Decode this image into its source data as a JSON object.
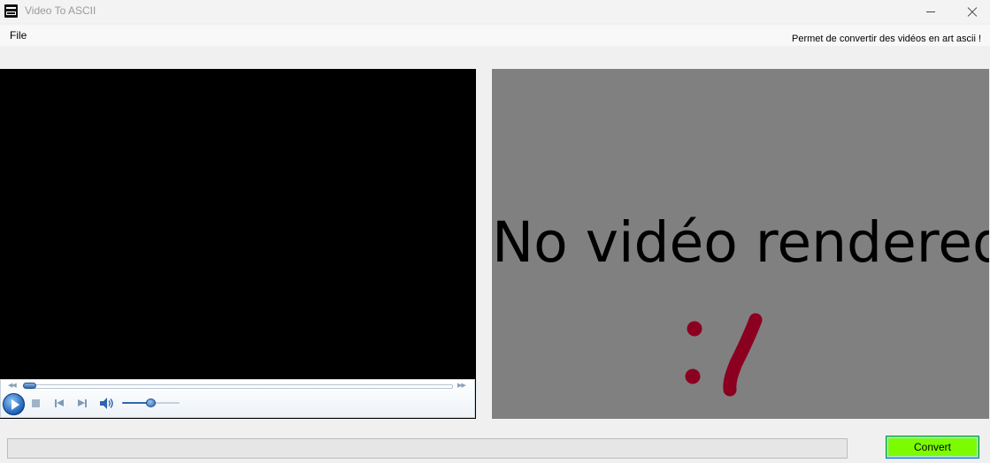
{
  "window": {
    "title": "Video To ASCII",
    "icon": "app-icon",
    "controls": [
      "minimize-icon",
      "maximize-icon",
      "close-icon"
    ]
  },
  "menu": {
    "items": [
      {
        "label": "File"
      }
    ],
    "description": "Permet de convertir des vidéos en art ascii !"
  },
  "player": {
    "background": "#000000",
    "seek_position": 0.01,
    "volume_level": 0.5,
    "icons": [
      "rewind-icon",
      "fast-forward-icon",
      "play-icon",
      "stop-icon",
      "previous-icon",
      "next-icon",
      "volume-icon"
    ]
  },
  "render": {
    "background": "#808080",
    "message": "No vidéo rendered",
    "emoticon": ":/",
    "emoticon_color": "#8b0020"
  },
  "progress": {
    "value": 0
  },
  "convert": {
    "label": "Convert",
    "background": "#7cfc00"
  }
}
